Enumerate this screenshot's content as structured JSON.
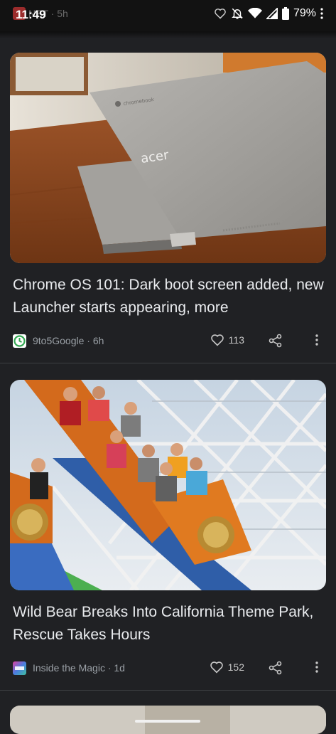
{
  "status_bar": {
    "time": "11:49",
    "behind_text": "NET · 5h",
    "battery": "79%",
    "icons": [
      "heart-outline-icon",
      "notifications-off-icon",
      "wifi-icon",
      "signal-icon",
      "battery-icon",
      "more-dots-icon"
    ]
  },
  "cards": [
    {
      "image_alt": "acer Chromebook laptop on wooden table",
      "image_brand_text": "acer",
      "image_logo_text": "chromebook",
      "title": "Chrome OS 101: Dark boot screen added, new Launcher starts appearing, more",
      "source": "9to5Google",
      "age": "6h",
      "meta": "9to5Google · 6h",
      "likes": "113",
      "source_icon": "clock-green-icon",
      "accent": "#34a853"
    },
    {
      "image_alt": "Riders on a roller coaster at a theme park",
      "title": "Wild Bear Breaks Into California Theme Park, Rescue Takes Hours",
      "source": "Inside the Magic",
      "age": "1d",
      "meta": "Inside the Magic · 1d",
      "likes": "152",
      "source_icon": "itm-logo-icon",
      "accent": "#e040a0"
    }
  ],
  "colors": {
    "background": "#202124",
    "status_bar": "#121212",
    "title_text": "#e8eaed",
    "meta_text": "#9aa0a6"
  }
}
